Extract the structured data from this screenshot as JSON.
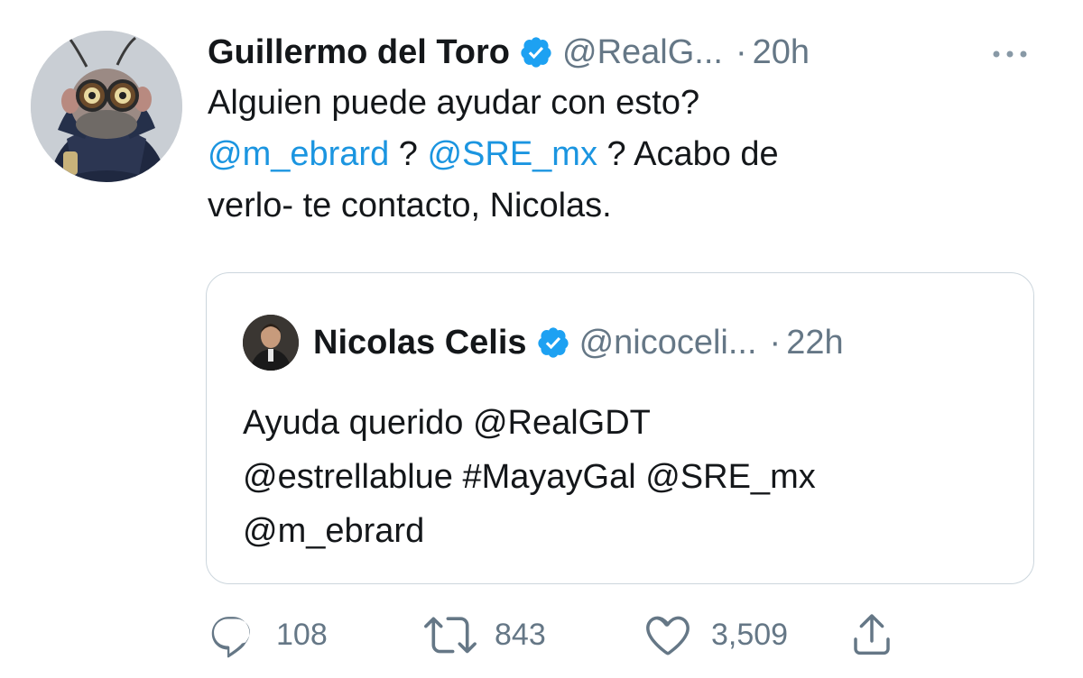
{
  "author": {
    "name": "Guillermo del Toro",
    "handle": "@RealG...",
    "separator": "·",
    "time": "20h"
  },
  "tweet": {
    "line1": "Alguien puede ayudar con esto?",
    "mention1": "@m_ebrard",
    "sep1": " ? ",
    "mention2": "@SRE_mx",
    "sep2": " ? Acabo de",
    "line3": "verlo- te contacto, Nicolas."
  },
  "quoted": {
    "name": "Nicolas Celis",
    "handle": "@nicoceli...",
    "separator": "·",
    "time": "22h",
    "line1": "Ayuda querido @RealGDT",
    "line2": "@estrellablue #MayayGal @SRE_mx",
    "line3": "@m_ebrard"
  },
  "actions": {
    "replies": "108",
    "retweets": "843",
    "likes": "3,509"
  },
  "colors": {
    "link": "#1b95e0",
    "secondary": "#657786",
    "verified": "#1da1f2",
    "border": "#ccd6dd"
  },
  "icons": [
    "verified-badge-icon",
    "more-icon",
    "reply-icon",
    "retweet-icon",
    "like-icon",
    "share-icon"
  ]
}
